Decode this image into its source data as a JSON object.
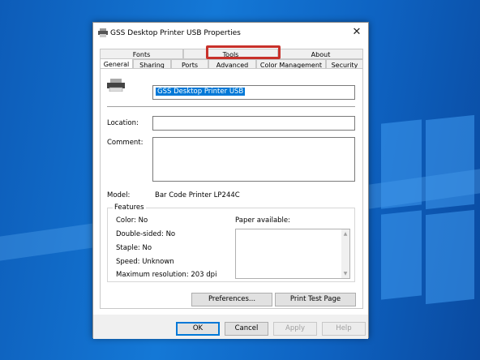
{
  "window": {
    "title": "GSS Desktop Printer USB Properties"
  },
  "tabs": {
    "row1": [
      "Fonts",
      "Tools",
      "About"
    ],
    "row2": [
      "General",
      "Sharing",
      "Ports",
      "Advanced",
      "Color Management",
      "Security"
    ]
  },
  "general": {
    "printer_name": "GSS Desktop Printer USB",
    "location_label": "Location:",
    "location_value": "",
    "comment_label": "Comment:",
    "comment_value": "",
    "model_label": "Model:",
    "model_value": "Bar Code Printer LP244C"
  },
  "features": {
    "legend": "Features",
    "color": "Color: No",
    "double_sided": "Double-sided: No",
    "staple": "Staple: No",
    "speed": "Speed: Unknown",
    "max_resolution": "Maximum resolution: 203 dpi",
    "paper_available_label": "Paper available:"
  },
  "buttons": {
    "preferences": "Preferences...",
    "print_test_page": "Print Test Page",
    "ok": "OK",
    "cancel": "Cancel",
    "apply": "Apply",
    "help": "Help"
  },
  "colors": {
    "highlight": "#c8312a",
    "selection": "#0078d7",
    "desktop": "#1478d6"
  }
}
